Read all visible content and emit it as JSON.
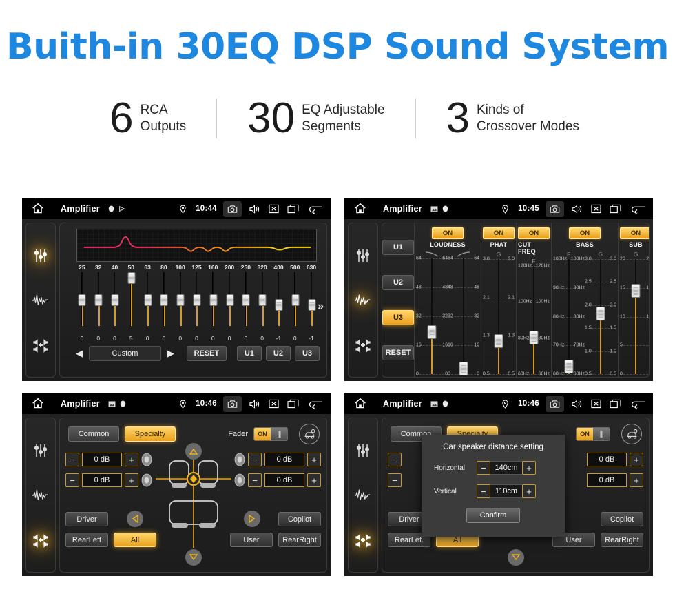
{
  "hero": {
    "title": "Buith-in 30EQ DSP Sound System"
  },
  "stats": [
    {
      "number": "6",
      "line1": "RCA",
      "line2": "Outputs"
    },
    {
      "number": "30",
      "line1": "EQ Adjustable",
      "line2": "Segments"
    },
    {
      "number": "3",
      "line1": "Kinds of",
      "line2": "Crossover Modes"
    }
  ],
  "colors": {
    "brand_blue": "#1e87e0",
    "accent_amber": "#e8a01c",
    "slider_amber": "#d79a22",
    "screen_bg": "#1f1f1f"
  },
  "panels": {
    "eq": {
      "status": {
        "title": "Amplifier",
        "time": "10:44",
        "icons": [
          "home-icon",
          "record-icon",
          "play-icon",
          "location-icon",
          "camera-icon",
          "volume-icon",
          "close-icon",
          "recent-apps-icon",
          "back-icon"
        ]
      },
      "rail": [
        "equalizer-icon",
        "waveform-icon",
        "balance-icon"
      ],
      "rail_active_index": 0,
      "graph": {
        "freq_labels": [
          "25",
          "32",
          "40",
          "50",
          "63",
          "80",
          "100",
          "125",
          "160",
          "200",
          "250",
          "320",
          "400",
          "500",
          "630"
        ]
      },
      "slider_values": [
        "0",
        "0",
        "0",
        "5",
        "0",
        "0",
        "0",
        "0",
        "0",
        "0",
        "0",
        "0",
        "-1",
        "0",
        "-1"
      ],
      "more_label": "»",
      "prev_label": "◀",
      "next_label": "▶",
      "preset": "Custom",
      "reset_label": "RESET",
      "user_buttons": [
        "U1",
        "U2",
        "U3"
      ]
    },
    "dsp": {
      "status": {
        "title": "Amplifier",
        "time": "10:45"
      },
      "rail_active_index": 1,
      "presets": [
        "U1",
        "U2",
        "U3"
      ],
      "preset_active": "U3",
      "reset_label": "RESET",
      "columns": [
        {
          "name": "LOUDNESS",
          "state": "ON",
          "sub": [
            "curve-down-icon",
            "curve-up-icon"
          ],
          "sliders": [
            {
              "ticks": [
                "64",
                "48",
                "32",
                "16",
                "0"
              ],
              "value_pos": 0.36
            },
            {
              "ticks": [
                "64",
                "48",
                "32",
                "16",
                "0"
              ],
              "value_pos": 0.04
            }
          ]
        },
        {
          "name": "PHAT",
          "state": "ON",
          "sub": [
            "G"
          ],
          "sliders": [
            {
              "ticks": [
                "3.0",
                "2.1",
                "1.3",
                "0.5"
              ],
              "value_pos": 0.28
            }
          ]
        },
        {
          "name": "CUT FREQ",
          "state": "ON",
          "sub": [
            "F"
          ],
          "sliders": [
            {
              "ticks": [
                "120Hz",
                "100Hz",
                "80Hz",
                "60Hz"
              ],
              "value_pos": 0.33
            }
          ]
        },
        {
          "name": "BASS",
          "state": "ON",
          "sub": [
            "F",
            "G"
          ],
          "sliders": [
            {
              "ticks": [
                "100Hz",
                "90Hz",
                "80Hz",
                "70Hz",
                "60Hz"
              ],
              "value_pos": 0.06
            },
            {
              "ticks": [
                "3.0",
                "2.5",
                "2.0",
                "1.5",
                "1.0",
                "0.5"
              ],
              "value_pos": 0.52
            }
          ]
        },
        {
          "name": "SUB",
          "state": "ON",
          "sub": [
            "G"
          ],
          "sliders": [
            {
              "ticks": [
                "20",
                "15",
                "10",
                "5",
                "0"
              ],
              "value_pos": 0.72
            }
          ]
        }
      ]
    },
    "fader": {
      "status": {
        "title": "Amplifier",
        "time": "10:46"
      },
      "rail_active_index": 2,
      "tabs": [
        {
          "label": "Common",
          "active": false
        },
        {
          "label": "Specialty",
          "active": true
        }
      ],
      "fader_label": "Fader",
      "fader_state": "ON",
      "db_values": [
        "0 dB",
        "0 dB",
        "0 dB",
        "0 dB"
      ],
      "minus_label": "−",
      "plus_label": "+",
      "seat_buttons": [
        {
          "label": "Driver",
          "active": false
        },
        {
          "label": "Copilot",
          "active": false
        },
        {
          "label": "RearLeft",
          "active": false
        },
        {
          "label": "All",
          "active": true
        },
        {
          "label": "User",
          "active": false
        },
        {
          "label": "RearRight",
          "active": false
        }
      ]
    },
    "distance": {
      "status": {
        "title": "Amplifier",
        "time": "10:46"
      },
      "rail_active_index": 2,
      "tabs": [
        {
          "label": "Common",
          "active": false
        },
        {
          "label": "Specialty",
          "active": true
        }
      ],
      "fader_state": "ON",
      "db_values": [
        "0 dB",
        "0 dB"
      ],
      "seat_buttons": [
        {
          "label": "Driver",
          "active": false
        },
        {
          "label": "Copilot",
          "active": false
        },
        {
          "label": "RearLef.",
          "active": false
        },
        {
          "label": "All",
          "active": true
        },
        {
          "label": "User",
          "active": false
        },
        {
          "label": "RearRight",
          "active": false
        }
      ],
      "dialog": {
        "title": "Car speaker distance setting",
        "rows": [
          {
            "label": "Horizontal",
            "value": "140cm"
          },
          {
            "label": "Vertical",
            "value": "110cm"
          }
        ],
        "confirm_label": "Confirm",
        "minus_label": "−",
        "plus_label": "+"
      }
    }
  }
}
